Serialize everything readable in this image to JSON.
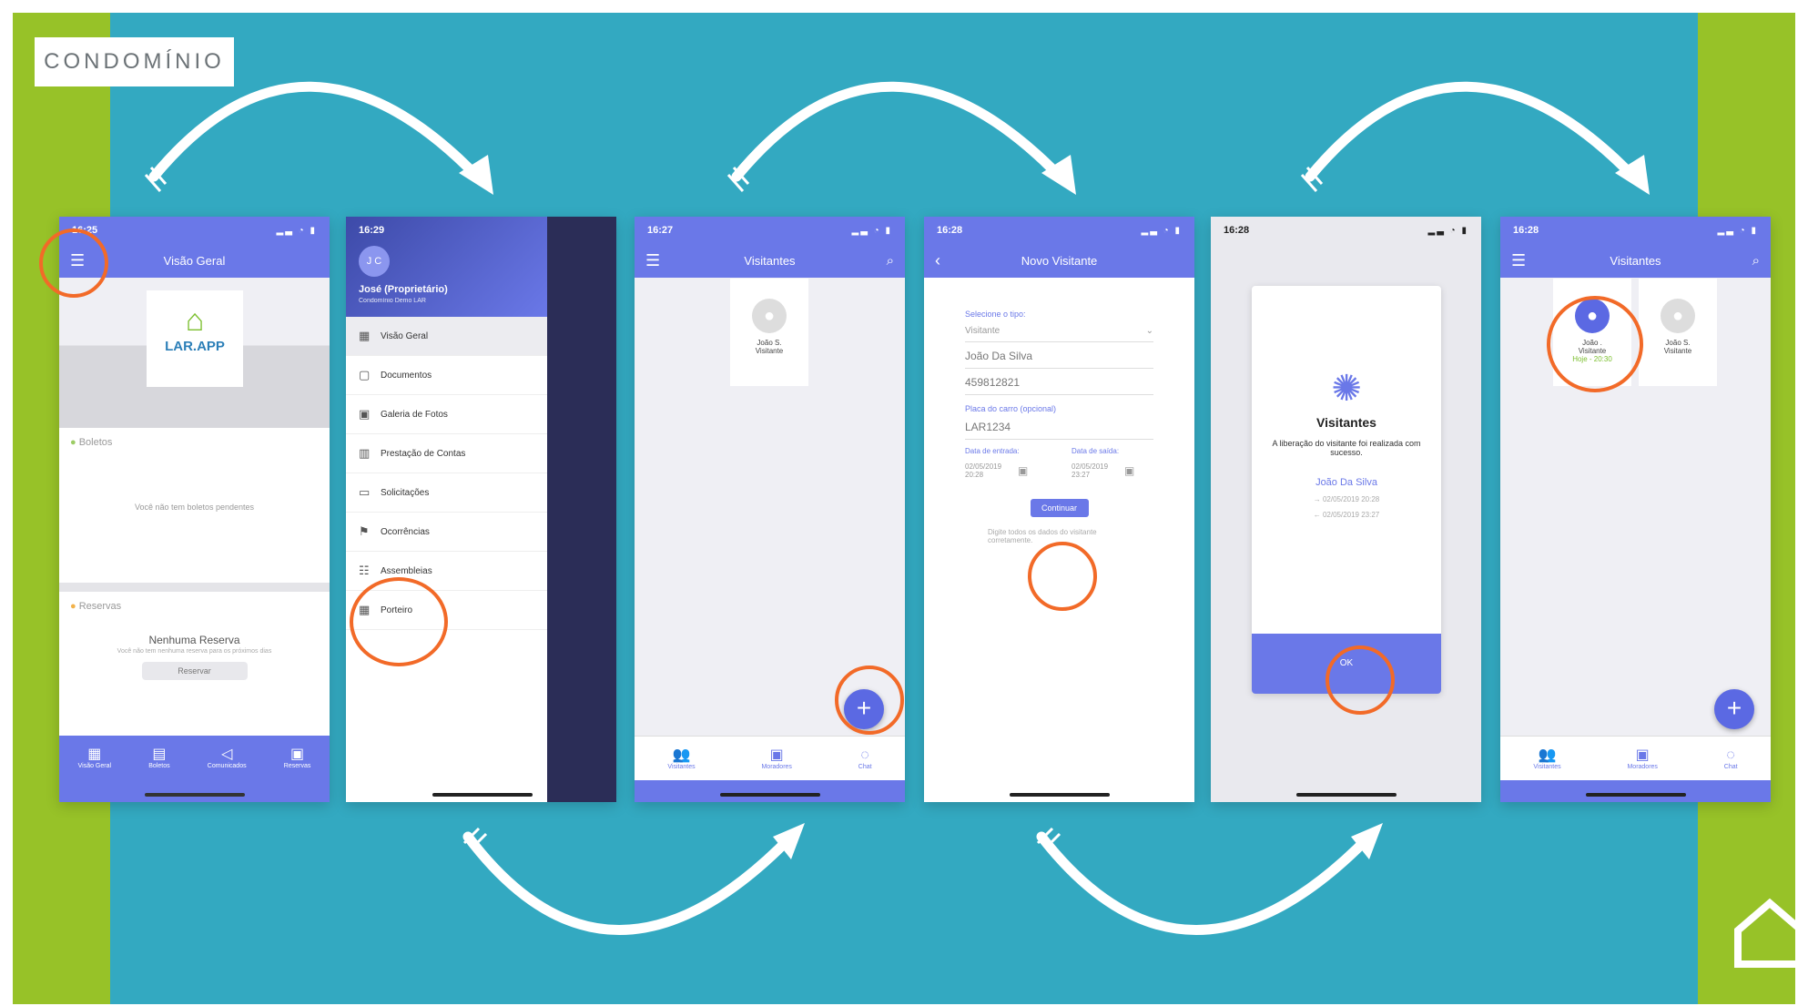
{
  "category_tag": "CONDOMÍNIO",
  "screen1": {
    "time": "16:25",
    "title": "Visão Geral",
    "logo_text": "LAR.APP",
    "boletos_label": "Boletos",
    "boletos_empty": "Você não tem boletos pendentes",
    "reservas_label": "Reservas",
    "no_reserva_title": "Nenhuma Reserva",
    "no_reserva_text": "Você não tem nenhuma reserva para os próximos dias",
    "reservar_button": "Reservar",
    "tabs": [
      "Visão Geral",
      "Boletos",
      "Comunicados",
      "Reservas"
    ]
  },
  "screen2": {
    "time": "16:29",
    "avatar_initials": "J C",
    "user_name": "José (Proprietário)",
    "condo_name": "Condomínio Demo LAR",
    "menu": [
      "Visão Geral",
      "Documentos",
      "Galeria de Fotos",
      "Prestação de Contas",
      "Solicitações",
      "Ocorrências",
      "Assembleias",
      "Porteiro"
    ]
  },
  "screen3": {
    "time": "16:27",
    "title": "Visitantes",
    "visitor_name": "João S.",
    "visitor_type": "Visitante",
    "tabs": [
      "Visitantes",
      "Moradores",
      "Chat"
    ]
  },
  "screen4": {
    "time": "16:28",
    "title": "Novo Visitante",
    "type_label": "Selecione o tipo:",
    "type_value": "Visitante",
    "name_value": "João Da Silva",
    "doc_value": "459812821",
    "plate_label": "Placa do carro (opcional)",
    "plate_value": "LAR1234",
    "entry_label": "Data de entrada:",
    "exit_label": "Data de saída:",
    "entry_value": "02/05/2019 20:28",
    "exit_value": "02/05/2019 23:27",
    "continue_button": "Continuar",
    "hint": "Digite todos os dados do visitante corretamente."
  },
  "screen5": {
    "time": "16:28",
    "title": "Visitantes",
    "message": "A liberação do visitante foi realizada com sucesso.",
    "visitor_name": "João Da Silva",
    "entry": "02/05/2019 20:28",
    "exit": "02/05/2019 23:27",
    "ok_button": "OK"
  },
  "screen6": {
    "time": "16:28",
    "title": "Visitantes",
    "card1_name": "João .",
    "card1_type": "Visitante",
    "card1_time": "Hoje - 20:30",
    "card2_name": "João S.",
    "card2_type": "Visitante",
    "tabs": [
      "Visitantes",
      "Moradores",
      "Chat"
    ]
  },
  "colors": {
    "accent": "#6a78e8",
    "highlight_ring": "#f26a28",
    "background": "#33a9c1",
    "side_band": "#97c228"
  }
}
